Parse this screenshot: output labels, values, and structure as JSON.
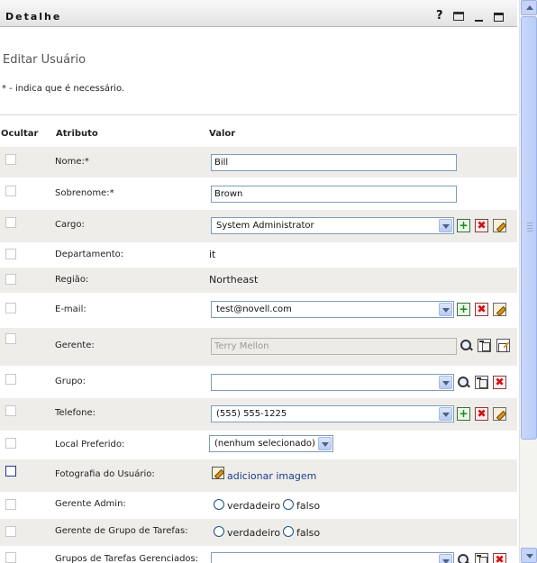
{
  "titlebar": {
    "title": "Detalhe",
    "help_icon": "?",
    "icons": [
      "help-icon",
      "print-icon",
      "minimize-icon",
      "maximize-icon"
    ]
  },
  "page": {
    "title": "Editar Usuário",
    "required_note": "* - indica que é necessário."
  },
  "columns": {
    "hide": "Ocultar",
    "attribute": "Atributo",
    "value": "Valor"
  },
  "rows": {
    "nome": {
      "label": "Nome:*",
      "value": "Bill"
    },
    "sobrenome": {
      "label": "Sobrenome:*",
      "value": "Brown"
    },
    "cargo": {
      "label": "Cargo:",
      "value": "System Administrator"
    },
    "departamento": {
      "label": "Departamento:",
      "value": "it"
    },
    "regiao": {
      "label": "Região:",
      "value": "Northeast"
    },
    "email": {
      "label": "E-mail:",
      "value": "test@novell.com"
    },
    "gerente": {
      "label": "Gerente:",
      "value": "Terry Mellon"
    },
    "grupo": {
      "label": "Grupo:",
      "value": ""
    },
    "telefone": {
      "label": "Telefone:",
      "value": "(555) 555-1225"
    },
    "local_preferido": {
      "label": "Local Preferido:",
      "value": "(nenhum selecionado)"
    },
    "fotografia": {
      "label": "Fotografia do Usuário:",
      "link": "adicionar imagem"
    },
    "gerente_admin": {
      "label": "Gerente Admin:",
      "true_label": "verdadeiro",
      "false_label": "falso"
    },
    "gerente_grupo_tarefas": {
      "label": "Gerente de Grupo de Tarefas:",
      "true_label": "verdadeiro",
      "false_label": "falso"
    },
    "grupos_tarefas": {
      "label": "Grupos de Tarefas Gerenciados:",
      "value": ""
    }
  },
  "colors": {
    "alt_row": "#eeedea",
    "input_border": "#7f9db9",
    "link": "#1b3e8c",
    "add_green": "#138a13",
    "delete_red": "#d01010"
  }
}
